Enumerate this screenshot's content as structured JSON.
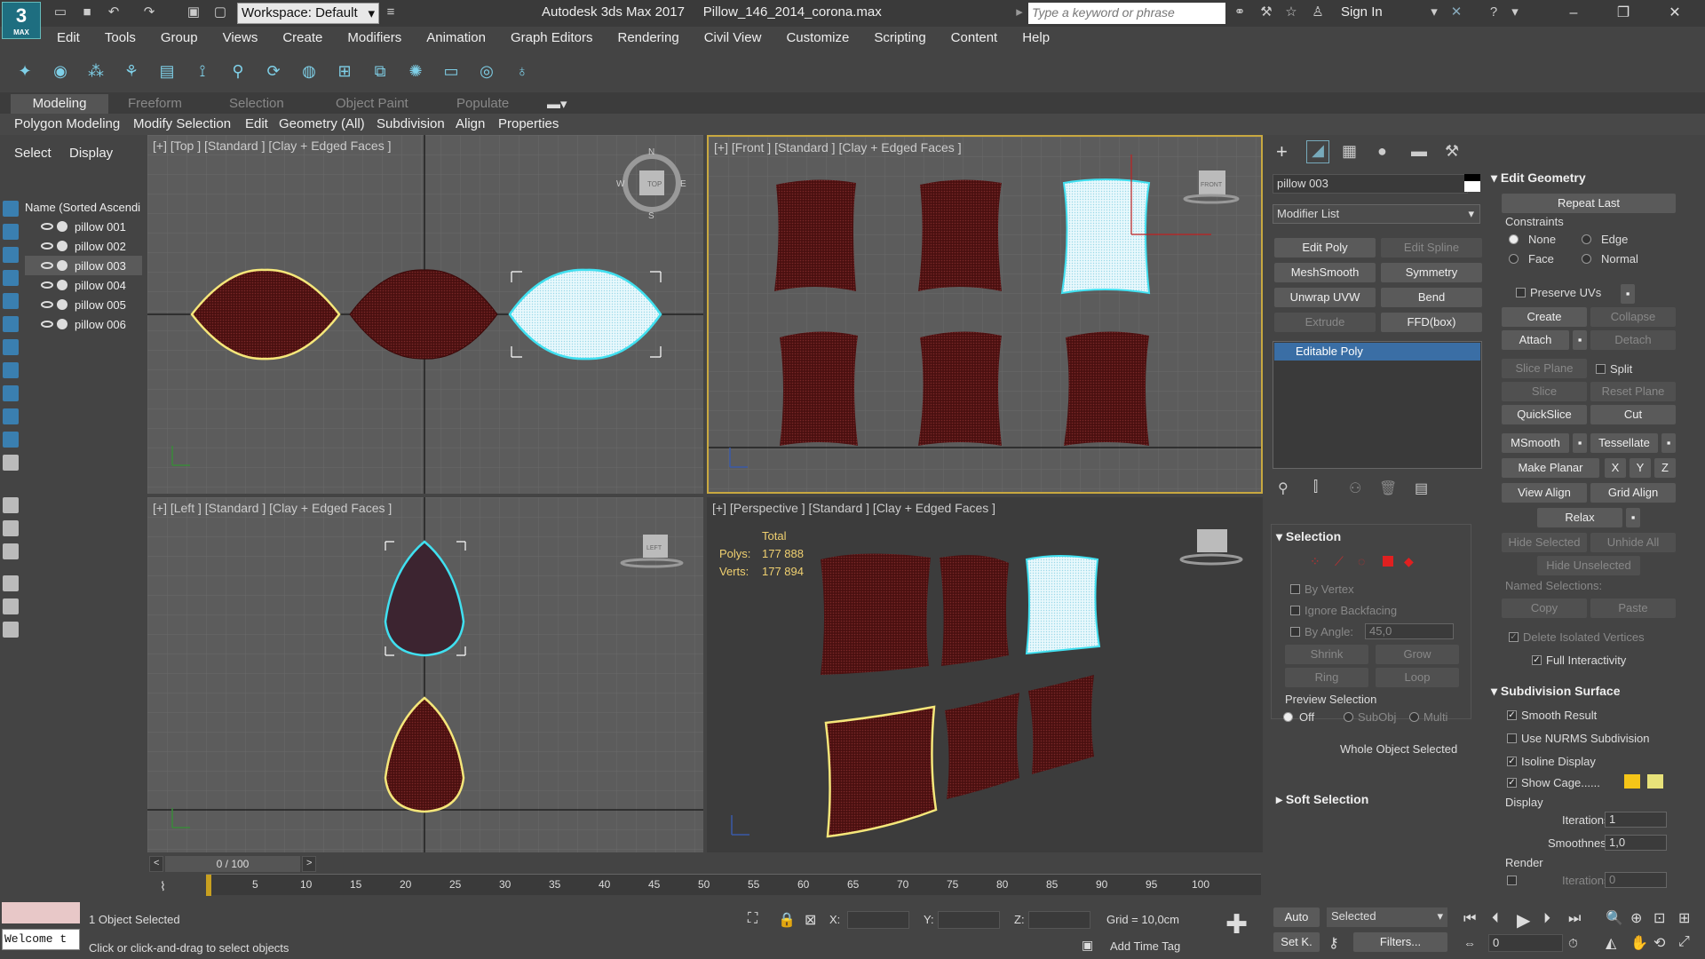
{
  "app": {
    "logo_text": "3",
    "logo_sub": "MAX",
    "workspace": "Workspace: Default",
    "title": "Autodesk 3ds Max 2017",
    "file": "Pillow_146_2014_corona.max",
    "search_placeholder": "Type a keyword or phrase",
    "sign_in": "Sign In"
  },
  "menu": [
    "Edit",
    "Tools",
    "Group",
    "Views",
    "Create",
    "Modifiers",
    "Animation",
    "Graph Editors",
    "Rendering",
    "Civil View",
    "Customize",
    "Scripting",
    "Content",
    "Help"
  ],
  "ribbon": {
    "tabs": [
      "Modeling",
      "Freeform",
      "Selection",
      "Object Paint",
      "Populate"
    ],
    "row": [
      "Polygon Modeling",
      "Modify Selection",
      "Edit",
      "Geometry (All)",
      "Subdivision",
      "Align",
      "Properties"
    ]
  },
  "scene": {
    "tabs": [
      "Select",
      "Display"
    ],
    "header": "Name (Sorted Ascendi",
    "items": [
      "pillow 001",
      "pillow 002",
      "pillow 003",
      "pillow 004",
      "pillow 005",
      "pillow 006"
    ]
  },
  "viewports": {
    "top": "[+] [Top ] [Standard ] [Clay + Edged Faces ]",
    "front": "[+] [Front ] [Standard ] [Clay + Edged Faces ]",
    "left": "[+] [Left ] [Standard ] [Clay + Edged Faces ]",
    "perspective": "[+] [Perspective ] [Standard ] [Clay + Edged Faces ]",
    "stats": {
      "total": "Total",
      "polys_label": "Polys:",
      "polys": "177 888",
      "verts_label": "Verts:",
      "verts": "177 894"
    },
    "compass": {
      "n": "N",
      "s": "S",
      "e": "E",
      "w": "W"
    },
    "cube": {
      "top": "TOP",
      "front": "FRONT",
      "left": "LEFT"
    }
  },
  "command_panel": {
    "object_name": "pillow 003",
    "modifier_list": "Modifier List",
    "buttons": [
      [
        "Edit Poly",
        "Edit Spline"
      ],
      [
        "MeshSmooth",
        "Symmetry"
      ],
      [
        "Unwrap UVW",
        "Bend"
      ],
      [
        "Extrude",
        "FFD(box)"
      ]
    ],
    "stack_item": "Editable Poly",
    "selection": {
      "title": "Selection",
      "by_vertex": "By Vertex",
      "ignore_backfacing": "Ignore Backfacing",
      "by_angle": "By Angle:",
      "angle": "45,0",
      "shrink": "Shrink",
      "grow": "Grow",
      "ring": "Ring",
      "loop": "Loop",
      "preview": "Preview Selection",
      "off": "Off",
      "subobj": "SubObj",
      "multi": "Multi",
      "whole": "Whole Object Selected"
    },
    "soft_selection": "Soft Selection"
  },
  "edit_geometry": {
    "title": "Edit Geometry",
    "repeat_last": "Repeat Last",
    "constraints": "Constraints",
    "none": "None",
    "edge": "Edge",
    "face": "Face",
    "normal": "Normal",
    "preserve_uvs": "Preserve UVs",
    "create": "Create",
    "collapse": "Collapse",
    "attach": "Attach",
    "detach": "Detach",
    "slice_plane": "Slice Plane",
    "split": "Split",
    "slice": "Slice",
    "reset_plane": "Reset Plane",
    "quickslice": "QuickSlice",
    "cut": "Cut",
    "msmooth": "MSmooth",
    "tessellate": "Tessellate",
    "make_planar": "Make Planar",
    "x": "X",
    "y": "Y",
    "z": "Z",
    "view_align": "View Align",
    "grid_align": "Grid Align",
    "relax": "Relax",
    "hide_selected": "Hide Selected",
    "unhide_all": "Unhide All",
    "hide_unselected": "Hide Unselected",
    "named_selections": "Named Selections:",
    "copy": "Copy",
    "paste": "Paste",
    "delete_isolated": "Delete Isolated Vertices",
    "full_interactivity": "Full Interactivity"
  },
  "subdivision": {
    "title": "Subdivision Surface",
    "smooth_result": "Smooth Result",
    "use_nurms": "Use NURMS Subdivision",
    "isoline": "Isoline Display",
    "show_cage": "Show Cage......",
    "display": "Display",
    "iterations_label": "Iterations:",
    "iterations": "1",
    "smoothness_label": "Smoothness:",
    "smoothness": "1,0",
    "render": "Render",
    "render_iterations": "0",
    "cage_color_1": "#f5c518",
    "cage_color_2": "#e8e27a"
  },
  "timeline": {
    "frame": "0 / 100",
    "ticks": [
      "0",
      "5",
      "10",
      "15",
      "20",
      "25",
      "30",
      "35",
      "40",
      "45",
      "50",
      "55",
      "60",
      "65",
      "70",
      "75",
      "80",
      "85",
      "90",
      "95",
      "100"
    ]
  },
  "status": {
    "maxscript": "Welcome t",
    "selected": "1 Object Selected",
    "prompt": "Click or click-and-drag to select objects",
    "x_label": "X:",
    "y_label": "Y:",
    "z_label": "Z:",
    "grid": "Grid = 10,0cm",
    "add_time_tag": "Add Time Tag",
    "auto": "Auto",
    "set_key": "Set K.",
    "selected_dropdown": "Selected",
    "filters": "Filters...",
    "frame_field": "0"
  },
  "colors": {
    "pillow": "#5a1818",
    "selected_fill": "#d8f0f8",
    "selected_outline": "#40e0f0",
    "yellow_outline": "#f5e77a",
    "active_border": "#c8a840",
    "stack_highlight": "#3a6ea5"
  }
}
